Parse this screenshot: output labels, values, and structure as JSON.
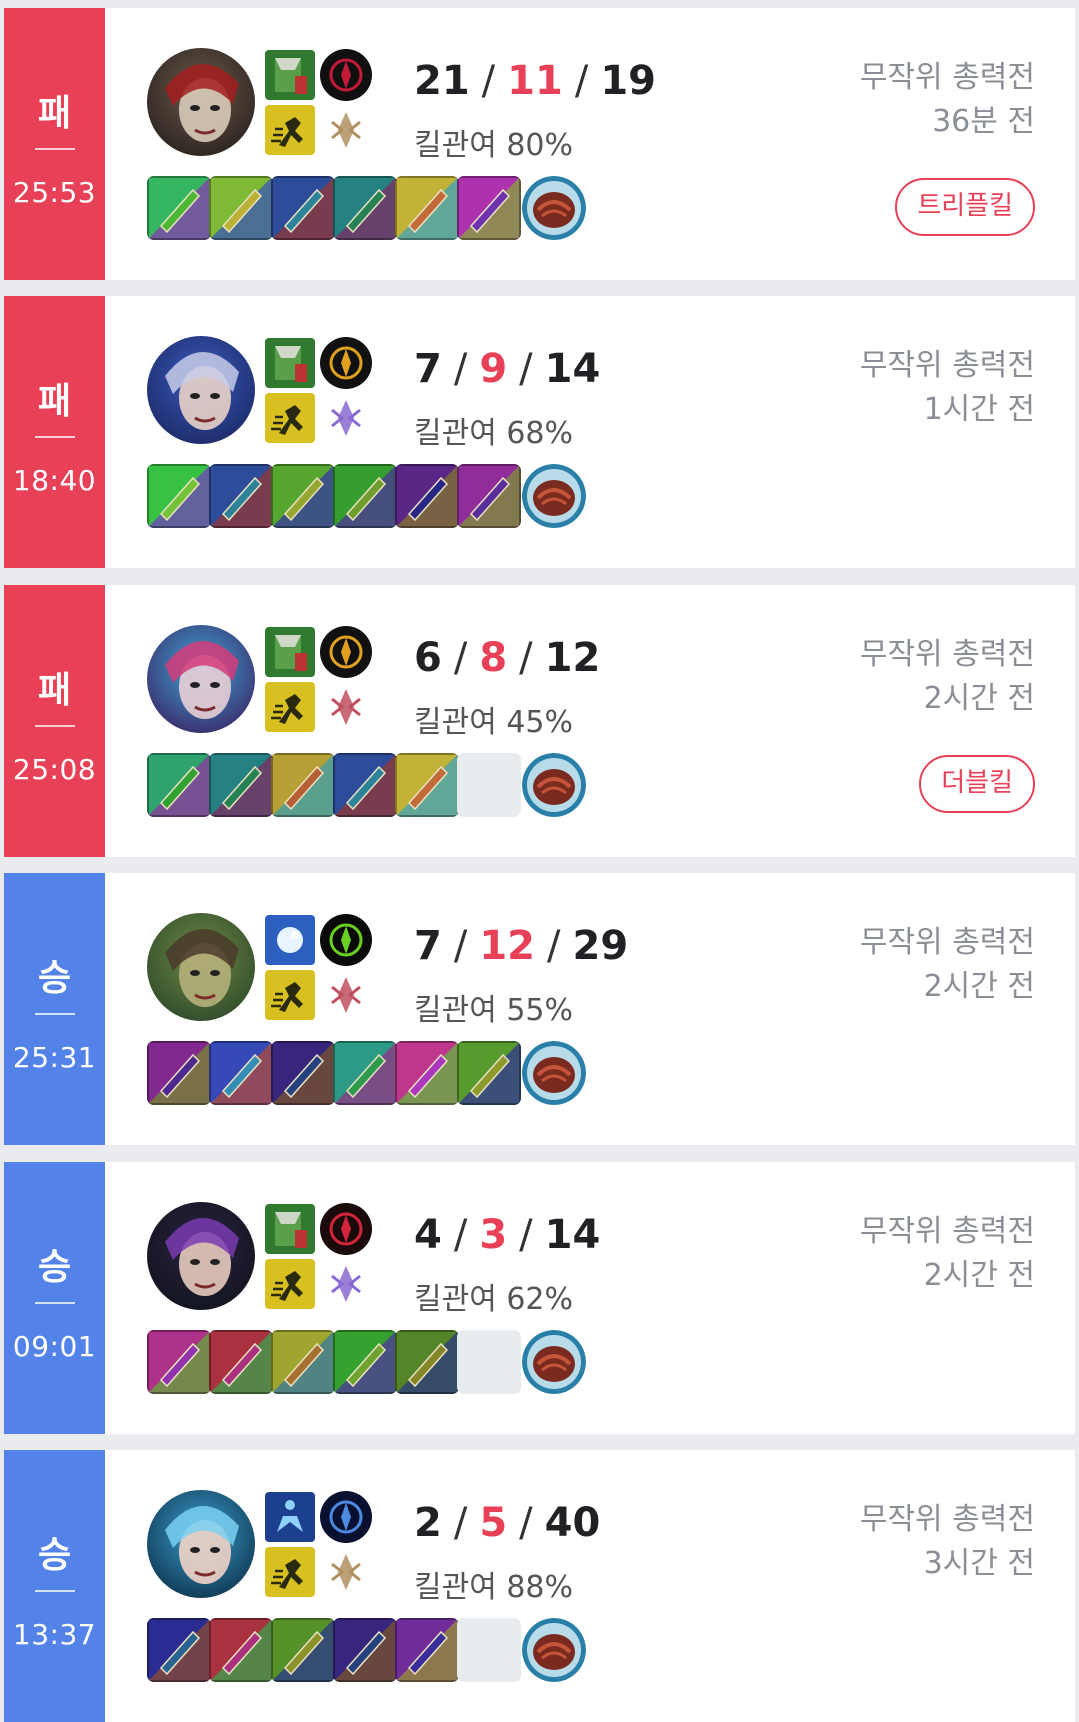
{
  "colors": {
    "loss": "#e84057",
    "win": "#5383e8",
    "deaths": "#e84057",
    "muted_text": "#8a8f96",
    "background": "#e9ebef"
  },
  "matches": [
    {
      "result": "패",
      "outcome": "loss",
      "duration": "25:53",
      "champion_icon": "champion-portrait-skull-mask",
      "spell_icons": [
        "mark-icon",
        "ghost-icon"
      ],
      "rune_icons": [
        "dark-harvest-icon",
        "sorcery-tree-icon"
      ],
      "kills": "21",
      "deaths": "11",
      "assists": "19",
      "kill_participation": "킬관여 80%",
      "mode": "무작위 총력전",
      "ago": "36분 전",
      "multikill": "트리플킬",
      "item_icons": [
        "orb-staff-icon",
        "purple-blade-icon",
        "steel-boots-icon",
        "green-claw-icon",
        "spear-icon",
        "purple-wave-icon"
      ],
      "ward_icon": "poro-snax-icon"
    },
    {
      "result": "패",
      "outcome": "loss",
      "duration": "18:40",
      "champion_icon": "champion-portrait-blue-hood",
      "spell_icons": [
        "mark-icon",
        "ghost-icon"
      ],
      "rune_icons": [
        "lethal-tempo-icon",
        "inspiration-tree-icon"
      ],
      "kills": "7",
      "deaths": "9",
      "assists": "14",
      "kill_participation": "킬관여 68%",
      "mode": "무작위 총력전",
      "ago": "1시간 전",
      "multikill": "",
      "item_icons": [
        "red-sword-icon",
        "steel-boots-icon",
        "dagger-icon",
        "crossbow-icon",
        "axe-icon",
        "dark-cleaver-icon"
      ],
      "ward_icon": "poro-snax-icon"
    },
    {
      "result": "패",
      "outcome": "loss",
      "duration": "25:08",
      "champion_icon": "champion-portrait-blue-hair",
      "spell_icons": [
        "mark-icon",
        "ghost-icon"
      ],
      "rune_icons": [
        "lethal-tempo-icon",
        "precision-tree-icon"
      ],
      "kills": "6",
      "deaths": "8",
      "assists": "12",
      "kill_participation": "킬관여 45%",
      "mode": "무작위 총력전",
      "ago": "2시간 전",
      "multikill": "더블킬",
      "item_icons": [
        "lightning-blade-icon",
        "frost-bow-icon",
        "red-greatsword-icon",
        "steel-boots-icon",
        "spear-icon",
        ""
      ],
      "ward_icon": "poro-snax-icon"
    },
    {
      "result": "승",
      "outcome": "win",
      "duration": "25:31",
      "champion_icon": "champion-portrait-mummy",
      "spell_icons": [
        "snowball-icon",
        "ghost-icon"
      ],
      "rune_icons": [
        "aftershock-icon",
        "precision-tree-icon"
      ],
      "kills": "7",
      "deaths": "12",
      "assists": "29",
      "kill_participation": "킬관여 55%",
      "mode": "무작위 총력전",
      "ago": "2시간 전",
      "multikill": "",
      "item_icons": [
        "sunfire-icon",
        "armor-plate-icon",
        "purple-shield-icon",
        "red-boots-icon",
        "moss-armor-icon",
        "warmog-icon"
      ],
      "ward_icon": "poro-snax-icon"
    },
    {
      "result": "승",
      "outcome": "win",
      "duration": "09:01",
      "champion_icon": "champion-portrait-top-hat",
      "spell_icons": [
        "mark-icon",
        "ghost-icon"
      ],
      "rune_icons": [
        "predator-icon",
        "inspiration-tree-icon"
      ],
      "kills": "4",
      "deaths": "3",
      "assists": "14",
      "kill_participation": "킬관여 62%",
      "mode": "무작위 총력전",
      "ago": "2시간 전",
      "multikill": "",
      "item_icons": [
        "scythe-icon",
        "leather-boots-icon",
        "red-dagger-icon",
        "longsword-icon",
        "ruby-icon",
        ""
      ],
      "ward_icon": "poro-snax-icon"
    },
    {
      "result": "승",
      "outcome": "win",
      "duration": "13:37",
      "champion_icon": "champion-portrait-blue-mage",
      "spell_icons": [
        "clarity-icon",
        "ghost-icon"
      ],
      "rune_icons": [
        "arcane-comet-icon",
        "sorcery-tree-icon"
      ],
      "kills": "2",
      "deaths": "5",
      "assists": "40",
      "kill_participation": "킬관여 88%",
      "mode": "무작위 총력전",
      "ago": "3시간 전",
      "multikill": "",
      "item_icons": [
        "teal-staff-icon",
        "leather-boots-icon",
        "fire-wand-icon",
        "pink-tome-icon",
        "gold-scepter-icon",
        ""
      ],
      "ward_icon": "poro-snax-icon"
    }
  ]
}
